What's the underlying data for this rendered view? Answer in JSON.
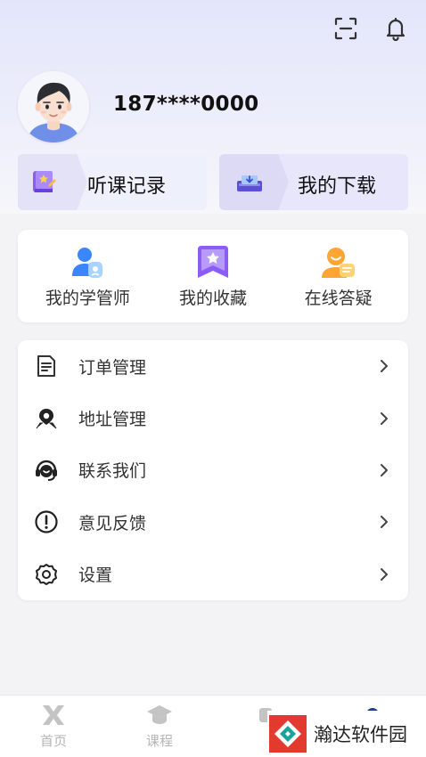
{
  "header": {
    "scan_icon": "scan-icon",
    "bell_icon": "bell-icon"
  },
  "profile": {
    "phone": "187****0000",
    "avatar": "avatar-boy"
  },
  "quick_links": [
    {
      "label": "听课记录",
      "icon": "course-record-icon"
    },
    {
      "label": "我的下载",
      "icon": "download-icon"
    }
  ],
  "services": [
    {
      "label": "我的学管师",
      "icon": "advisor-icon"
    },
    {
      "label": "我的收藏",
      "icon": "favorite-icon"
    },
    {
      "label": "在线答疑",
      "icon": "qa-icon"
    }
  ],
  "menu": [
    {
      "label": "订单管理",
      "icon": "order-icon"
    },
    {
      "label": "地址管理",
      "icon": "location-icon"
    },
    {
      "label": "联系我们",
      "icon": "support-icon"
    },
    {
      "label": "意见反馈",
      "icon": "feedback-icon"
    },
    {
      "label": "设置",
      "icon": "settings-icon"
    }
  ],
  "tabbar": [
    {
      "label": "首页",
      "icon": "home-icon"
    },
    {
      "label": "课程",
      "icon": "course-icon"
    },
    {
      "label": "",
      "icon": "learn-icon"
    },
    {
      "label": "",
      "icon": "profile-icon"
    }
  ],
  "watermark": {
    "text": "瀚达软件园"
  },
  "colors": {
    "accent": "#7b5cf0",
    "header_gradient_top": "#e3e6fb",
    "tab_inactive": "#b5b5b5",
    "tab_active": "#1a3f8f"
  }
}
